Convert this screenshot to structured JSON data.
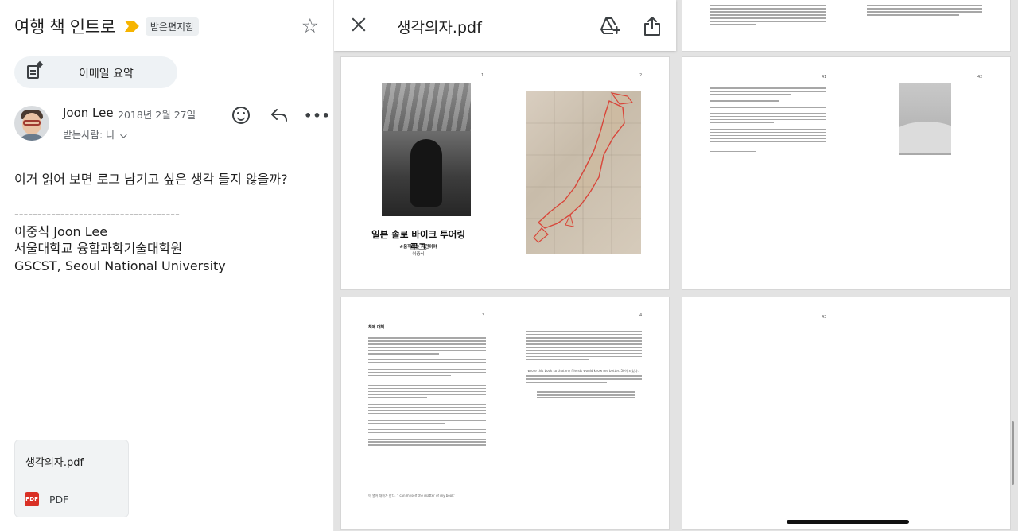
{
  "email": {
    "subject": "여행 책 인트로",
    "label": "받은편지함",
    "summary_button": "이메일 요약",
    "sender": "Joon Lee",
    "date": "2018년 2월 27일",
    "recipient": "받는사람: 나",
    "body": "이거 읽어 보면 로그 남기고 싶은 생각 들지 않을까?",
    "signature": "------------------------------------\n이중식 Joon Lee\n서울대학교 융합과학기술대학원\nGSCST, Seoul National University",
    "attachment": {
      "name": "생각의자.pdf",
      "badge": "PDF",
      "type": "PDF"
    },
    "icons": {
      "star": "star-icon",
      "react": "emoji-icon",
      "reply": "reply-icon",
      "more": "more-icon",
      "importance": "importance-marker-icon",
      "summary": "summary-icon"
    }
  },
  "viewer": {
    "title": "생각의자.pdf",
    "icons": {
      "close": "close-icon",
      "drive": "add-to-drive-icon",
      "share": "share-icon"
    },
    "pages": {
      "p1_title": "일본 솔로 바이크 투어링 로그",
      "p1_sub": "#움직이는 자전이야",
      "p1_author": "이중식",
      "p1_num": "1",
      "p2_num": "2",
      "p3_num": "3",
      "p3_head": "책에 대해",
      "p4_num": "4",
      "p4_quote_head": "I wrote this book so that my friends would know me better. 50이 되었다.",
      "p3_end": "이 열어 대화가 한다. 'I can myself the matter of my book'",
      "p41_num": "41",
      "p42_num": "42",
      "p43_num": "43"
    }
  },
  "colors": {
    "accent_pdf": "#d93025",
    "importance": "#f6b400",
    "route": "#d9463a"
  }
}
